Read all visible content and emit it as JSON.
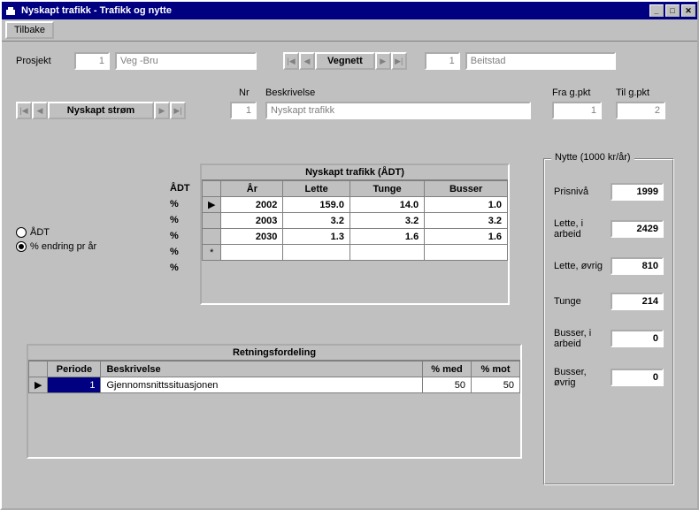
{
  "window": {
    "title": "Nyskapt trafikk - Trafikk og nytte"
  },
  "menu": {
    "back": "Tilbake"
  },
  "project": {
    "label": "Prosjekt",
    "id": "1",
    "name": "Veg -Bru"
  },
  "vegnett": {
    "label": "Vegnett",
    "id": "1",
    "name": "Beitstad"
  },
  "strom": {
    "label": "Nyskapt strøm",
    "nr_label": "Nr",
    "nr": "1",
    "beskrivelse_label": "Beskrivelse",
    "beskrivelse": "Nyskapt trafikk",
    "fra_label": "Fra g.pkt",
    "fra": "1",
    "til_label": "Til g.pkt",
    "til": "2"
  },
  "mode": {
    "adt_label": "ÅDT",
    "pct_label": "% endring pr år"
  },
  "adt_col": {
    "header": "ÅDT",
    "unit": "%"
  },
  "traffic_grid": {
    "caption": "Nyskapt trafikk (ÅDT)",
    "cols": {
      "year": "År",
      "lette": "Lette",
      "tunge": "Tunge",
      "busser": "Busser"
    },
    "rows": [
      {
        "year": "2002",
        "lette": "159.0",
        "tunge": "14.0",
        "busser": "1.0"
      },
      {
        "year": "2003",
        "lette": "3.2",
        "tunge": "3.2",
        "busser": "3.2"
      },
      {
        "year": "2030",
        "lette": "1.3",
        "tunge": "1.6",
        "busser": "1.6"
      }
    ]
  },
  "dir_grid": {
    "caption": "Retningsfordeling",
    "cols": {
      "periode": "Periode",
      "beskrivelse": "Beskrivelse",
      "med": "% med",
      "mot": "% mot"
    },
    "rows": [
      {
        "periode": "1",
        "beskrivelse": "Gjennomsnittssituasjonen",
        "med": "50",
        "mot": "50"
      }
    ]
  },
  "nytte": {
    "caption": "Nytte (1000 kr/år)",
    "prisniva_label": "Prisnivå",
    "prisniva": "1999",
    "lette_arbeid_label": "Lette, i arbeid",
    "lette_arbeid": "2429",
    "lette_ovrig_label": "Lette, øvrig",
    "lette_ovrig": "810",
    "tunge_label": "Tunge",
    "tunge": "214",
    "busser_arbeid_label": "Busser, i arbeid",
    "busser_arbeid": "0",
    "busser_ovrig_label": "Busser, øvrig",
    "busser_ovrig": "0"
  }
}
